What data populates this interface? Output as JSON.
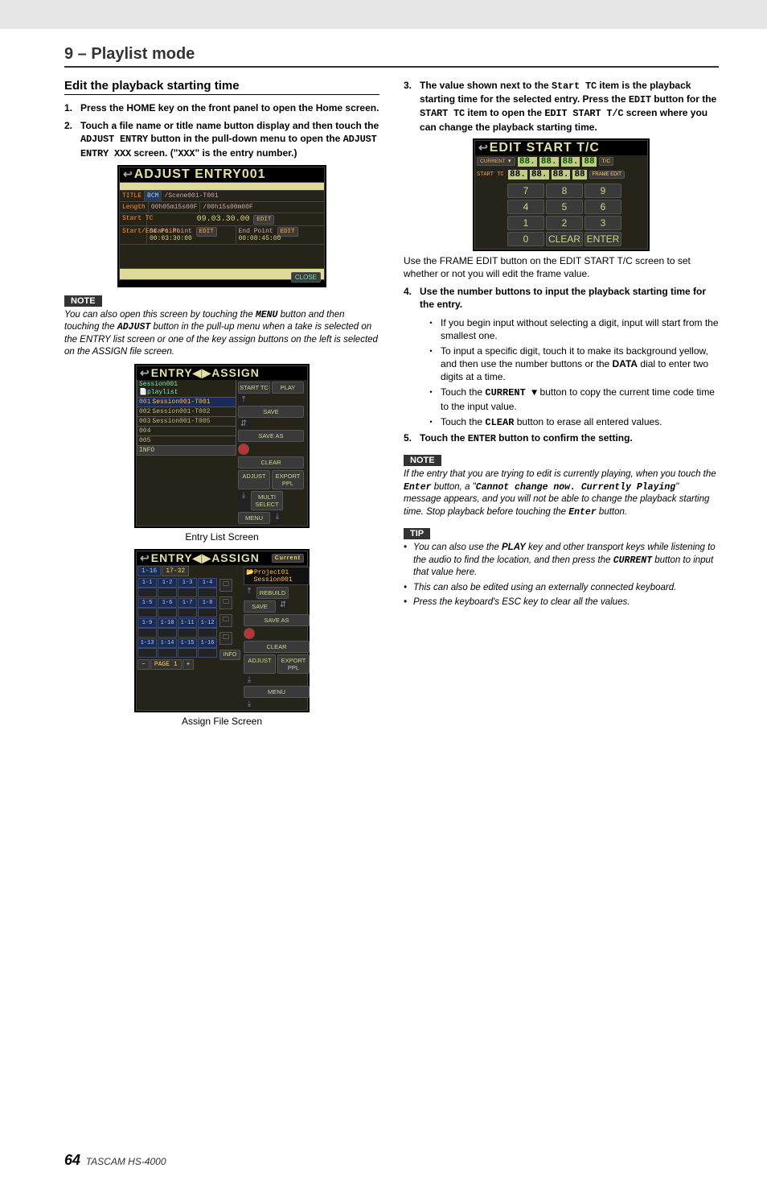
{
  "chapter": "9 – Playlist mode",
  "section_title": "Edit the playback starting time",
  "steps_left": [
    {
      "n": "1.",
      "text": "Press the HOME key on the front panel to open the Home screen."
    },
    {
      "n": "2.",
      "html": "Touch a file name or title name button display and then touch the <span class='ui'>ADJUST ENTRY</span> button in the pull-down menu to open the <span class='ui'>ADJUST ENTRY XXX</span> screen. (\"<span class='ui'>XXX</span>\" is the entry number.)"
    }
  ],
  "note1_label": "NOTE",
  "note1_html": "You can also open this screen by touching the <span class='note-ui'>MENU</span> button and then touching the <span class='note-ui'>ADJUST</span> button in the pull-up menu when a take is selected on the ENTRY list screen or one of the key assign buttons on the left is selected on the ASSIGN file screen.",
  "caption_entry": "Entry List Screen",
  "caption_assign": "Assign File Screen",
  "adjust_screen": {
    "title": "ADJUST ENTRY001",
    "rows": {
      "title_label": "TITLE",
      "bcm": "BCM",
      "title_val": "/Scene001-T001",
      "length_label": "Length",
      "length_val": "00h05m15s00F",
      "length_val2": "/00h15s00m00F",
      "starttc_label": "Start TC",
      "starttc_val": "09.03.30.00",
      "edit": "EDIT",
      "sp_label": "Start Point",
      "sp_val": "00:03:30:00",
      "ep_label": "End Point",
      "ep_val": "00:08:45:00",
      "sep_label": "Start/End Point",
      "close": "CLOSE"
    }
  },
  "entry_screen": {
    "title": "ENTRY◀▶ASSIGN",
    "session": "Session001",
    "playlist": "playlist",
    "items": [
      {
        "n": "001",
        "t": "Session001-T001",
        "sel": true
      },
      {
        "n": "002",
        "t": "Session001-T002"
      },
      {
        "n": "003",
        "t": "Session001-T005"
      },
      {
        "n": "004",
        "t": ""
      },
      {
        "n": "005",
        "t": ""
      }
    ],
    "side": {
      "starttc": "START TC",
      "play": "PLAY",
      "save": "SAVE",
      "saveas": "SAVE AS",
      "clear": "CLEAR",
      "adjust": "ADJUST",
      "exportppl": "EXPORT PPL",
      "multiselect": "MULTI SELECT",
      "menu": "MENU",
      "info": "INFO"
    }
  },
  "assign_screen": {
    "title": "ENTRY◀▶ASSIGN",
    "current": "Current",
    "tabs": [
      "1-16",
      "17-32"
    ],
    "proj": "Project01",
    "sess": "Session001",
    "slots": [
      "1-1",
      "1-2",
      "1-3",
      "1-4",
      "1-5",
      "1-6",
      "1-7",
      "1-8",
      "1-9",
      "1-10",
      "1-11",
      "1-12",
      "1-13",
      "1-14",
      "1-15",
      "1-16"
    ],
    "page_label": "PAGE 1",
    "side": {
      "rebuild": "REBUILD",
      "save": "SAVE",
      "saveas": "SAVE AS",
      "clear": "CLEAR",
      "adjust": "ADJUST",
      "exportppl": "EXPORT PPL",
      "info": "INFO",
      "menu": "MENU"
    }
  },
  "steps_right": [
    {
      "n": "3.",
      "html": "The value shown next to the <span class='ui'>Start TC</span> item is the playback starting time for the selected entry. Press the <span class='ui'>EDIT</span> button for the <span class='ui'>START TC</span> item to open the <span class='ui'>EDIT START T/C</span> screen where you can change the playback starting time."
    }
  ],
  "edit_tc": {
    "title": "EDIT START T/C",
    "current_label": "CURRENT ▼",
    "starttc_label": "START TC",
    "tc": "T/C",
    "frame_edit": "FRAME EDIT",
    "segs": [
      "88.",
      "88.",
      "88.",
      "88"
    ],
    "segs2": [
      "88.",
      "88.",
      "88.",
      "88"
    ],
    "keys": [
      "7",
      "8",
      "9",
      "4",
      "5",
      "6",
      "1",
      "2",
      "3",
      "0",
      "CLEAR",
      "ENTER"
    ]
  },
  "after_tc_html": "Use the <span class='ui'>FRAME EDIT</span> button on the <span class='ui'>EDIT START T/C</span> screen to set whether or not you will edit the frame value.",
  "step4": {
    "n": "4.",
    "text": "Use the number buttons to input the playback starting time for the entry."
  },
  "step4_bullets": [
    "If you begin input without selecting a digit, input will start from the smallest one.",
    "To input a specific digit, touch it to make its background yellow, and then use the number buttons or the <b>DATA</b> dial to enter two digits at a time.",
    "Touch the <span class='ui'>CURRENT ▼</span> button to copy the current time code time to the input value.",
    "Touch the <span class='ui'>CLEAR</span> button to erase all entered values."
  ],
  "step5": {
    "n": "5.",
    "html": "Touch the <span class='ui'>ENTER</span> button to confirm the setting."
  },
  "note2_label": "NOTE",
  "note2_html": "If the entry that you are trying to edit is currently playing, when you touch the <span class='note-ui'>Enter</span> button, a \"<span class='note-ui'>Cannot change now. Currently Playing</span>\" message appears, and you will not be able to change the playback starting time. Stop playback before touching the <span class='note-ui'>Enter</span> button.",
  "tip_label": "TIP",
  "tips": [
    "You can also use the <b>PLAY</b> key and other transport keys while listening to the audio to find the location, and then press the <span class='note-ui'>CURRENT</span> button to input that value here.",
    "This can also be edited using an externally connected keyboard.",
    "Press the keyboard's ESC key to clear all the values."
  ],
  "footer": {
    "page": "64",
    "model": "TASCAM HS-4000"
  }
}
